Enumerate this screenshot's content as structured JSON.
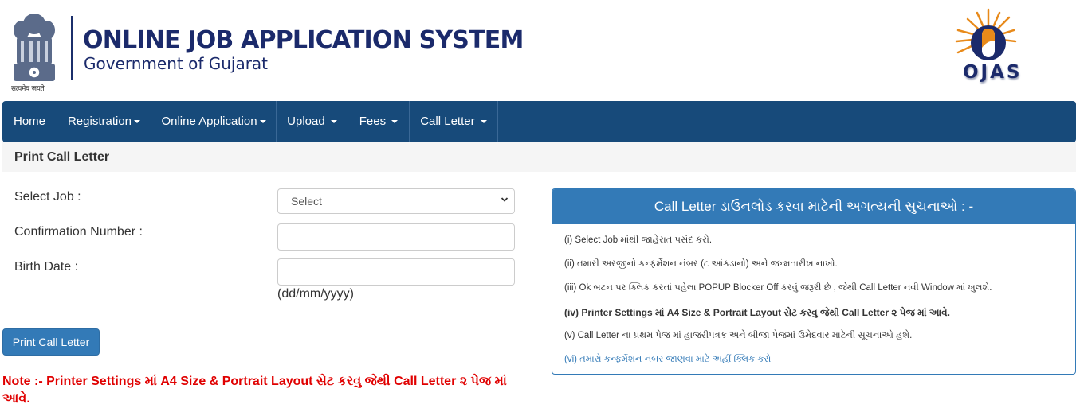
{
  "header": {
    "emblem_caption": "सत्यमेव जयते",
    "title": "ONLINE JOB APPLICATION SYSTEM",
    "subtitle": "Government of Gujarat",
    "logo_text": "OJAS",
    "icons": {
      "emblem": "national-emblem-icon",
      "logo": "ojas-sun-logo-icon"
    }
  },
  "nav": {
    "items": [
      {
        "label": "Home",
        "dropdown": false
      },
      {
        "label": "Registration",
        "dropdown": true
      },
      {
        "label": "Online Application",
        "dropdown": true
      },
      {
        "label": "Upload",
        "dropdown": true
      },
      {
        "label": "Fees",
        "dropdown": true
      },
      {
        "label": "Call Letter",
        "dropdown": true
      }
    ]
  },
  "page": {
    "title": "Print Call Letter"
  },
  "form": {
    "select_job": {
      "label": "Select Job :",
      "value": "Select",
      "options": [
        "Select"
      ]
    },
    "confirmation_number": {
      "label": "Confirmation Number :",
      "value": "",
      "placeholder": ""
    },
    "birth_date": {
      "label": "Birth Date :",
      "value": "",
      "placeholder": "",
      "hint": "(dd/mm/yyyy)"
    },
    "submit_label": "Print Call Letter",
    "note": "Note :- Printer Settings માં A4 Size & Portrait Layout સેટ કરવુ જેથી Call Letter ૨ પેજ માં આવે."
  },
  "instructions": {
    "heading": "Call Letter ડાઉનલોડ કરવા માટેની અગત્યની સુચનાઓ : -",
    "items": [
      {
        "text": "(i) Select Job માંથી જાહેરાત પસંદ કરો."
      },
      {
        "text": "(ii) તમારી અરજીનો કન્ફર્મેશન નંબર (૮ આંકડાનો) અને જન્મતારીખ નાખો."
      },
      {
        "text": "(iii) Ok બટન પર ક્લિક કરતાં પહેલા POPUP Blocker Off કરવું જરૂરી છે , જેથી Call Letter નવી Window માં ખુલશે."
      },
      {
        "text": "(iv) Printer Settings માં A4 Size & Portrait Layout સેટ કરવુ જેથી Call Letter ૨ પેજ માં આવે."
      },
      {
        "text": "(v) Call Letter ના પ્રથમ પેજ માં હાજરીપત્રક અને બીજા પેજમાં ઉમેદવાર માટેની સૂચનાઓ હશે."
      },
      {
        "text": "(vi) તમારો કન્ફર્મેશન નબર જાણવા માટે અહીં ક્લિક કરો"
      }
    ]
  },
  "colors": {
    "nav_bg": "#174a7a",
    "panel_primary": "#337ab7",
    "title_navy": "#1b2a6b",
    "note_red": "#e00000",
    "logo_orange": "#e88a1a"
  }
}
